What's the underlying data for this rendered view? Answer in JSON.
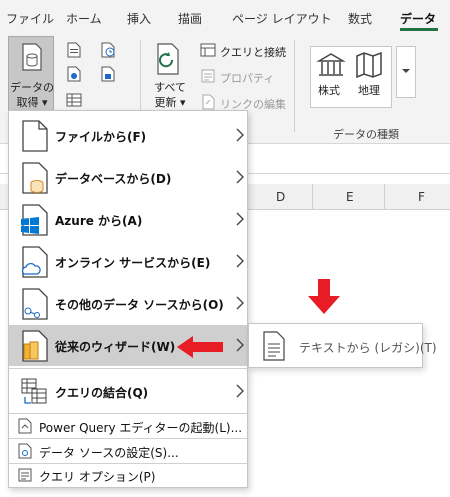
{
  "ribbon": {
    "tabs": [
      "ファイル",
      "ホーム",
      "挿入",
      "描画",
      "ページ レイアウト",
      "数式",
      "データ"
    ],
    "active_tab": "データ",
    "get_data_label_line1": "データの",
    "get_data_label_line2": "取得 ▾",
    "refresh_label_line1": "すべて",
    "refresh_label_line2": "更新 ▾",
    "queries_connections": "クエリと接続",
    "properties": "プロパティ",
    "edit_links": "リンクの編集",
    "stocks_label": "株式",
    "geography_label": "地理",
    "data_types_group": "データの種類"
  },
  "sheet": {
    "columns": [
      "D",
      "E",
      "F"
    ]
  },
  "menu": {
    "items": [
      {
        "label": "ファイルから(F)"
      },
      {
        "label": "データベースから(D)"
      },
      {
        "label": "Azure から(A)"
      },
      {
        "label": "オンライン サービスから(E)"
      },
      {
        "label": "その他のデータ ソースから(O)"
      },
      {
        "label": "従来のウィザード(W)"
      },
      {
        "label": "クエリの結合(Q)"
      }
    ],
    "bottom_items": [
      {
        "label": "Power Query エディターの起動(L)..."
      },
      {
        "label": "データ ソースの設定(S)..."
      },
      {
        "label": "クエリ オプション(P)"
      }
    ]
  },
  "submenu": {
    "label": "テキストから (レガシ)(T)"
  },
  "colors": {
    "accent_green": "#217346",
    "annotation_red": "#e81c24",
    "azure_blue": "#0078d4",
    "highlight_gray": "#cfcfcf"
  }
}
